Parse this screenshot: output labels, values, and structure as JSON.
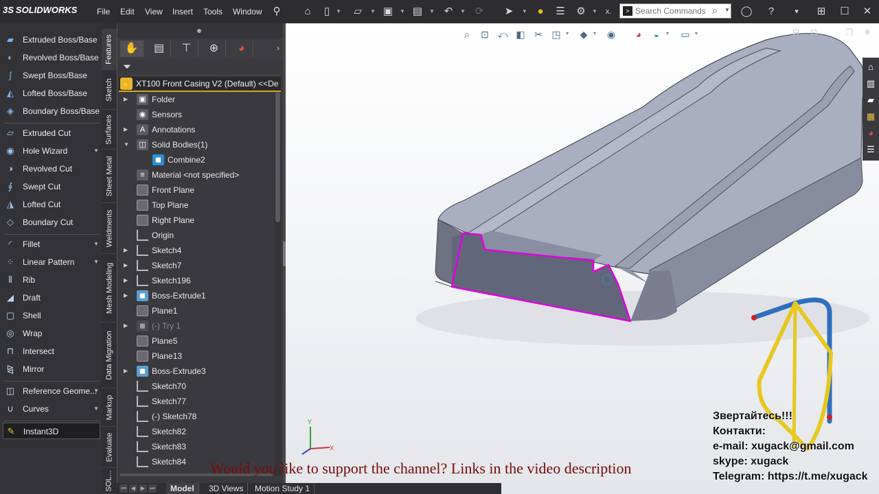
{
  "app": {
    "logo_text": "SOLIDWORKS",
    "logo_prefix": "3S"
  },
  "menu": [
    "File",
    "Edit",
    "View",
    "Insert",
    "Tools",
    "Window"
  ],
  "search": {
    "placeholder": "Search Commands"
  },
  "command_manager": {
    "items": [
      {
        "label": "Extruded Boss/Base",
        "icon": "extrude-icon"
      },
      {
        "label": "Revolved Boss/Base",
        "icon": "revolve-icon"
      },
      {
        "label": "Swept Boss/Base",
        "icon": "sweep-icon"
      },
      {
        "label": "Lofted Boss/Base",
        "icon": "loft-icon"
      },
      {
        "label": "Boundary Boss/Base",
        "icon": "boundary-icon"
      },
      {
        "label": "Extruded Cut",
        "icon": "extruded-cut-icon"
      },
      {
        "label": "Hole Wizard",
        "icon": "hole-icon"
      },
      {
        "label": "Revolved Cut",
        "icon": "revolved-cut-icon"
      },
      {
        "label": "Swept Cut",
        "icon": "swept-cut-icon"
      },
      {
        "label": "Lofted Cut",
        "icon": "lofted-cut-icon"
      },
      {
        "label": "Boundary Cut",
        "icon": "boundary-cut-icon"
      },
      {
        "label": "Fillet",
        "icon": "fillet-icon"
      },
      {
        "label": "Linear Pattern",
        "icon": "pattern-icon"
      },
      {
        "label": "Rib",
        "icon": "rib-icon"
      },
      {
        "label": "Draft",
        "icon": "draft-icon"
      },
      {
        "label": "Shell",
        "icon": "shell-icon"
      },
      {
        "label": "Wrap",
        "icon": "wrap-icon"
      },
      {
        "label": "Intersect",
        "icon": "intersect-icon"
      },
      {
        "label": "Mirror",
        "icon": "mirror-icon"
      },
      {
        "label": "Reference Geome...",
        "icon": "reference-geometry-icon"
      },
      {
        "label": "Curves",
        "icon": "curves-icon"
      },
      {
        "label": "Instant3D",
        "icon": "instant3d-icon"
      }
    ]
  },
  "vertical_tabs": [
    "Features",
    "Sketch",
    "Surfaces",
    "Sheet Metal",
    "Weldments",
    "Mesh Modeling",
    "Data Migration",
    "Markup",
    "Evaluate",
    "SOL..."
  ],
  "feature_manager": {
    "root": "XT100 Front Casing V2 (Default) <<De",
    "nodes": [
      {
        "label": "Folder"
      },
      {
        "label": "Sensors"
      },
      {
        "label": "Annotations"
      },
      {
        "label": "Solid Bodies(1)"
      },
      {
        "label": "Combine2"
      },
      {
        "label": "Material <not specified>"
      },
      {
        "label": "Front Plane"
      },
      {
        "label": "Top Plane"
      },
      {
        "label": "Right Plane"
      },
      {
        "label": "Origin"
      },
      {
        "label": "Sketch4"
      },
      {
        "label": "Sketch7"
      },
      {
        "label": "Sketch196"
      },
      {
        "label": "Boss-Extrude1"
      },
      {
        "label": "Plane1"
      },
      {
        "label": "(-) Try 1"
      },
      {
        "label": "Plane5"
      },
      {
        "label": "Plane13"
      },
      {
        "label": "Boss-Extrude3"
      },
      {
        "label": "Sketch70"
      },
      {
        "label": "Sketch77"
      },
      {
        "label": "(-) Sketch78"
      },
      {
        "label": "Sketch82"
      },
      {
        "label": "Sketch83"
      },
      {
        "label": "Sketch84"
      }
    ]
  },
  "bottom_tabs": [
    "Model",
    "3D Views",
    "Motion Study 1"
  ],
  "overlay": {
    "support": "Would you like to support the channel? Links in the video description",
    "contacts": [
      "Звертайтесь!!!",
      "Контакти:",
      "e-mail: xugack@gmail.com",
      "skype: xugack",
      "Telegram: https://t.me/xugack"
    ]
  },
  "triad": {
    "x": "X",
    "y": "Y"
  },
  "colors": {
    "accent": "#d8a820",
    "selection_edge": "#e000e0",
    "body": "#8a8ea0"
  }
}
